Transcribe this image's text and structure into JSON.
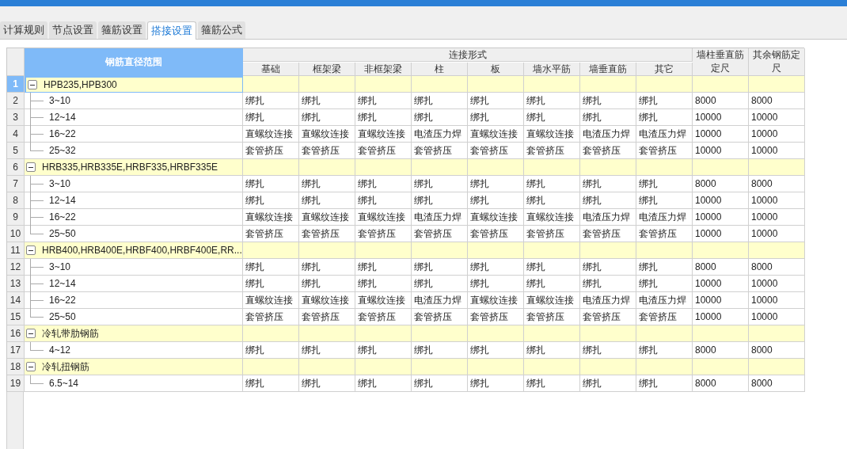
{
  "tabs": [
    {
      "label": "计算规则",
      "selected": false
    },
    {
      "label": "节点设置",
      "selected": false
    },
    {
      "label": "箍筋设置",
      "selected": false
    },
    {
      "label": "搭接设置",
      "selected": true
    },
    {
      "label": "箍筋公式",
      "selected": false
    }
  ],
  "table": {
    "tree_header": "钢筋直径范围",
    "group_header": "连接形式",
    "sub_columns": [
      "基础",
      "框架梁",
      "非框架梁",
      "柱",
      "板",
      "墙水平筋",
      "墙垂直筋",
      "其它"
    ],
    "extra_columns": [
      "墙柱垂直筋定尺",
      "其余钢筋定尺"
    ],
    "groups": [
      {
        "no": "1",
        "label": "HPB235,HPB300",
        "expanded": true,
        "selected": true,
        "children": [
          {
            "no": "2",
            "label": "3~10",
            "selected": false,
            "cells": [
              "绑扎",
              "绑扎",
              "绑扎",
              "绑扎",
              "绑扎",
              "绑扎",
              "绑扎",
              "绑扎",
              "8000",
              "8000"
            ]
          },
          {
            "no": "3",
            "label": "12~14",
            "selected": false,
            "cells": [
              "绑扎",
              "绑扎",
              "绑扎",
              "绑扎",
              "绑扎",
              "绑扎",
              "绑扎",
              "绑扎",
              "10000",
              "10000"
            ]
          },
          {
            "no": "4",
            "label": "16~22",
            "selected": false,
            "cells": [
              "直螺纹连接",
              "直螺纹连接",
              "直螺纹连接",
              "电渣压力焊",
              "直螺纹连接",
              "直螺纹连接",
              "电渣压力焊",
              "电渣压力焊",
              "10000",
              "10000"
            ]
          },
          {
            "no": "5",
            "label": "25~32",
            "selected": false,
            "cells": [
              "套管挤压",
              "套管挤压",
              "套管挤压",
              "套管挤压",
              "套管挤压",
              "套管挤压",
              "套管挤压",
              "套管挤压",
              "10000",
              "10000"
            ]
          }
        ]
      },
      {
        "no": "6",
        "label": "HRB335,HRB335E,HRBF335,HRBF335E",
        "expanded": true,
        "selected": false,
        "children": [
          {
            "no": "7",
            "label": "3~10",
            "selected": false,
            "cells": [
              "绑扎",
              "绑扎",
              "绑扎",
              "绑扎",
              "绑扎",
              "绑扎",
              "绑扎",
              "绑扎",
              "8000",
              "8000"
            ]
          },
          {
            "no": "8",
            "label": "12~14",
            "selected": false,
            "cells": [
              "绑扎",
              "绑扎",
              "绑扎",
              "绑扎",
              "绑扎",
              "绑扎",
              "绑扎",
              "绑扎",
              "10000",
              "10000"
            ]
          },
          {
            "no": "9",
            "label": "16~22",
            "selected": false,
            "cells": [
              "直螺纹连接",
              "直螺纹连接",
              "直螺纹连接",
              "电渣压力焊",
              "直螺纹连接",
              "直螺纹连接",
              "电渣压力焊",
              "电渣压力焊",
              "10000",
              "10000"
            ]
          },
          {
            "no": "10",
            "label": "25~50",
            "selected": false,
            "cells": [
              "套管挤压",
              "套管挤压",
              "套管挤压",
              "套管挤压",
              "套管挤压",
              "套管挤压",
              "套管挤压",
              "套管挤压",
              "10000",
              "10000"
            ]
          }
        ]
      },
      {
        "no": "11",
        "label": "HRB400,HRB400E,HRBF400,HRBF400E,RR...",
        "expanded": true,
        "selected": false,
        "children": [
          {
            "no": "12",
            "label": "3~10",
            "selected": false,
            "cells": [
              "绑扎",
              "绑扎",
              "绑扎",
              "绑扎",
              "绑扎",
              "绑扎",
              "绑扎",
              "绑扎",
              "8000",
              "8000"
            ]
          },
          {
            "no": "13",
            "label": "12~14",
            "selected": false,
            "cells": [
              "绑扎",
              "绑扎",
              "绑扎",
              "绑扎",
              "绑扎",
              "绑扎",
              "绑扎",
              "绑扎",
              "10000",
              "10000"
            ]
          },
          {
            "no": "14",
            "label": "16~22",
            "selected": false,
            "cells": [
              "直螺纹连接",
              "直螺纹连接",
              "直螺纹连接",
              "电渣压力焊",
              "直螺纹连接",
              "直螺纹连接",
              "电渣压力焊",
              "电渣压力焊",
              "10000",
              "10000"
            ]
          },
          {
            "no": "15",
            "label": "25~50",
            "selected": false,
            "cells": [
              "套管挤压",
              "套管挤压",
              "套管挤压",
              "套管挤压",
              "套管挤压",
              "套管挤压",
              "套管挤压",
              "套管挤压",
              "10000",
              "10000"
            ]
          }
        ]
      },
      {
        "no": "16",
        "label": "冷轧带肋钢筋",
        "expanded": true,
        "selected": false,
        "children": [
          {
            "no": "17",
            "label": "4~12",
            "selected": false,
            "cells": [
              "绑扎",
              "绑扎",
              "绑扎",
              "绑扎",
              "绑扎",
              "绑扎",
              "绑扎",
              "绑扎",
              "8000",
              "8000"
            ]
          }
        ]
      },
      {
        "no": "18",
        "label": "冷轧扭钢筋",
        "expanded": true,
        "selected": false,
        "children": [
          {
            "no": "19",
            "label": "6.5~14",
            "selected": false,
            "cells": [
              "绑扎",
              "绑扎",
              "绑扎",
              "绑扎",
              "绑扎",
              "绑扎",
              "绑扎",
              "绑扎",
              "8000",
              "8000"
            ]
          }
        ]
      }
    ]
  }
}
